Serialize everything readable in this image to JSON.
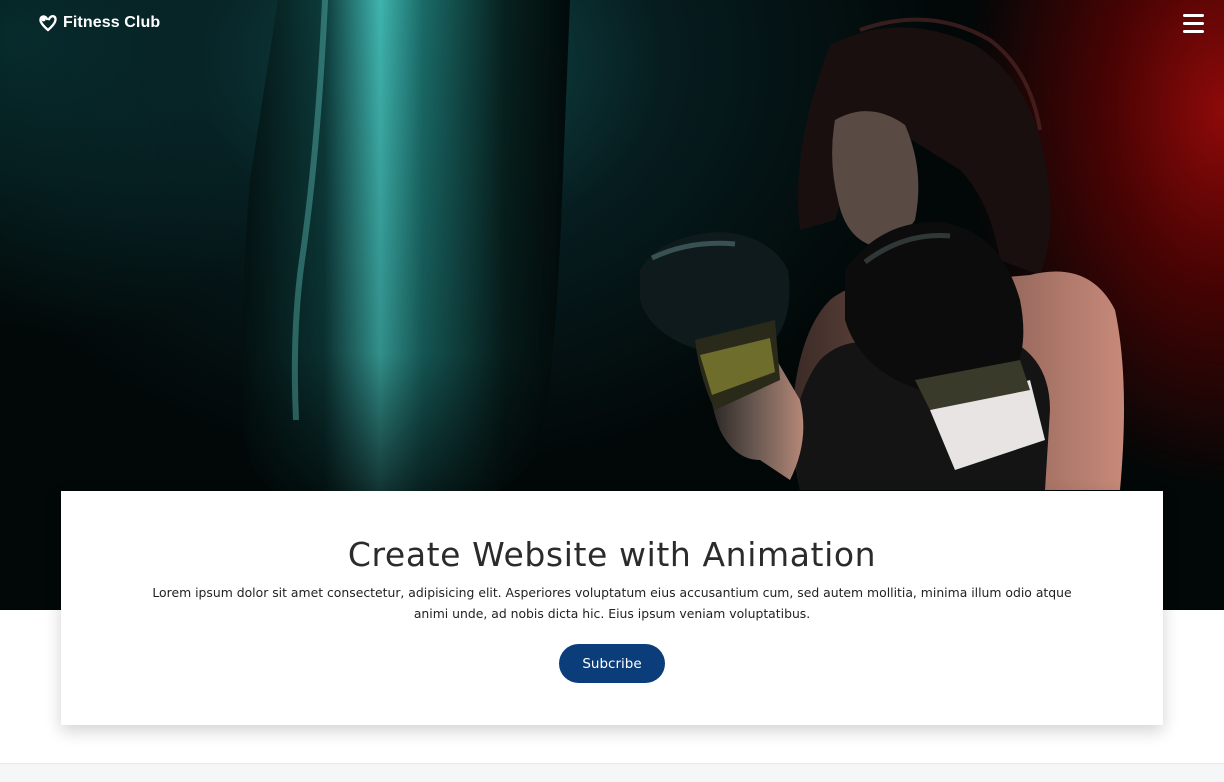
{
  "navbar": {
    "brand_name": "Fitness Club",
    "brand_icon": "heart-pulse-icon",
    "menu_icon": "hamburger-menu-icon"
  },
  "hero": {
    "image": "boxer-with-punching-bag-photo"
  },
  "card": {
    "title": "Create Website with Animation",
    "text": "Lorem ipsum dolor sit amet consectetur, adipisicing elit. Asperiores voluptatum eius accusantium cum, sed autem mollitia, minima illum odio atque animi unde, ad nobis dicta hic. Eius ipsum veniam voluptatibus.",
    "button_label": "Subcribe"
  },
  "colors": {
    "button_bg": "#0a3d7a",
    "hero_accent_red": "#960a0a",
    "hero_accent_teal": "#145a5a"
  }
}
